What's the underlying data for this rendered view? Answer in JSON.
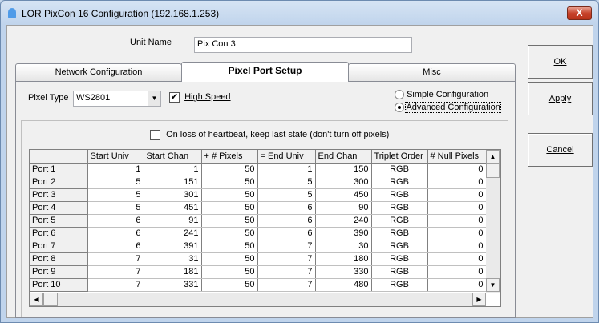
{
  "window": {
    "title": "LOR PixCon 16 Configuration (192.168.1.253)",
    "close_label": "X"
  },
  "unit_name": {
    "label": "Unit Name",
    "value": "Pix Con 3"
  },
  "buttons": {
    "ok": "OK",
    "apply": "Apply",
    "cancel": "Cancel"
  },
  "tabs": [
    {
      "label": "Network Configuration"
    },
    {
      "label": "Pixel Port Setup"
    },
    {
      "label": "Misc"
    }
  ],
  "pixel_type": {
    "label": "Pixel Type",
    "value": "WS2801"
  },
  "high_speed": {
    "label": "High Speed",
    "checked": true,
    "mark": "✔"
  },
  "config_mode": {
    "simple": "Simple Configuration",
    "advanced": "Advanced Configuration",
    "selected": "advanced"
  },
  "heartbeat": {
    "label": "On loss of heartbeat, keep last state (don't turn off pixels)",
    "checked": false
  },
  "grid": {
    "columns": [
      "Start Univ",
      "Start Chan",
      "+ # Pixels",
      "= End Univ",
      "End Chan",
      "Triplet Order",
      "# Null Pixels"
    ],
    "rows": [
      {
        "port": "Port 1",
        "cells": [
          "1",
          "1",
          "50",
          "1",
          "150",
          "RGB",
          "0"
        ]
      },
      {
        "port": "Port 2",
        "cells": [
          "5",
          "151",
          "50",
          "5",
          "300",
          "RGB",
          "0"
        ]
      },
      {
        "port": "Port 3",
        "cells": [
          "5",
          "301",
          "50",
          "5",
          "450",
          "RGB",
          "0"
        ]
      },
      {
        "port": "Port 4",
        "cells": [
          "5",
          "451",
          "50",
          "6",
          "90",
          "RGB",
          "0"
        ]
      },
      {
        "port": "Port 5",
        "cells": [
          "6",
          "91",
          "50",
          "6",
          "240",
          "RGB",
          "0"
        ]
      },
      {
        "port": "Port 6",
        "cells": [
          "6",
          "241",
          "50",
          "6",
          "390",
          "RGB",
          "0"
        ]
      },
      {
        "port": "Port 7",
        "cells": [
          "6",
          "391",
          "50",
          "7",
          "30",
          "RGB",
          "0"
        ]
      },
      {
        "port": "Port 8",
        "cells": [
          "7",
          "31",
          "50",
          "7",
          "180",
          "RGB",
          "0"
        ]
      },
      {
        "port": "Port 9",
        "cells": [
          "7",
          "181",
          "50",
          "7",
          "330",
          "RGB",
          "0"
        ]
      },
      {
        "port": "Port 10",
        "cells": [
          "7",
          "331",
          "50",
          "7",
          "480",
          "RGB",
          "0"
        ]
      }
    ]
  }
}
